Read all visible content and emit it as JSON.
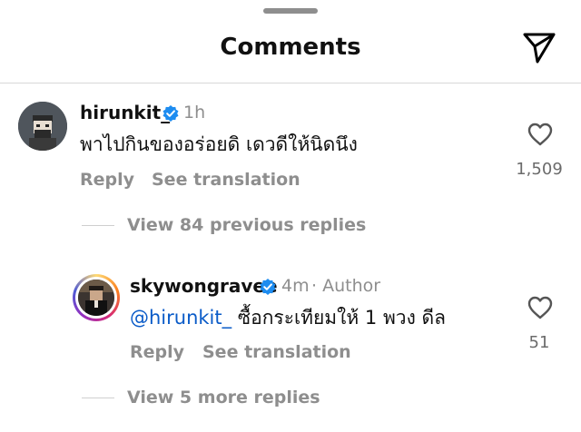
{
  "header": {
    "title": "Comments",
    "share_icon": "paper-plane-icon"
  },
  "comments": [
    {
      "username": "hirunkit_",
      "verified": true,
      "time": "1h",
      "text": "พาไปกินของอร่อยดิ เดวดีให้นิดนึง",
      "reply_label": "Reply",
      "translation_label": "See translation",
      "like_count": "1,509",
      "view_replies": "View 84 previous replies"
    },
    {
      "username": "skywongravee",
      "verified": true,
      "time": "4m",
      "author_tag": "· Author",
      "mention": "@hirunkit_",
      "text": "ซื้อกระเทียมให้ 1 พวง ดีล",
      "reply_label": "Reply",
      "translation_label": "See translation",
      "like_count": "51",
      "view_replies": "View 5 more replies"
    }
  ],
  "colors": {
    "verified_badge": "#1d8cf0",
    "mention": "#0a5bc8",
    "muted_text": "#8e8e8e"
  }
}
